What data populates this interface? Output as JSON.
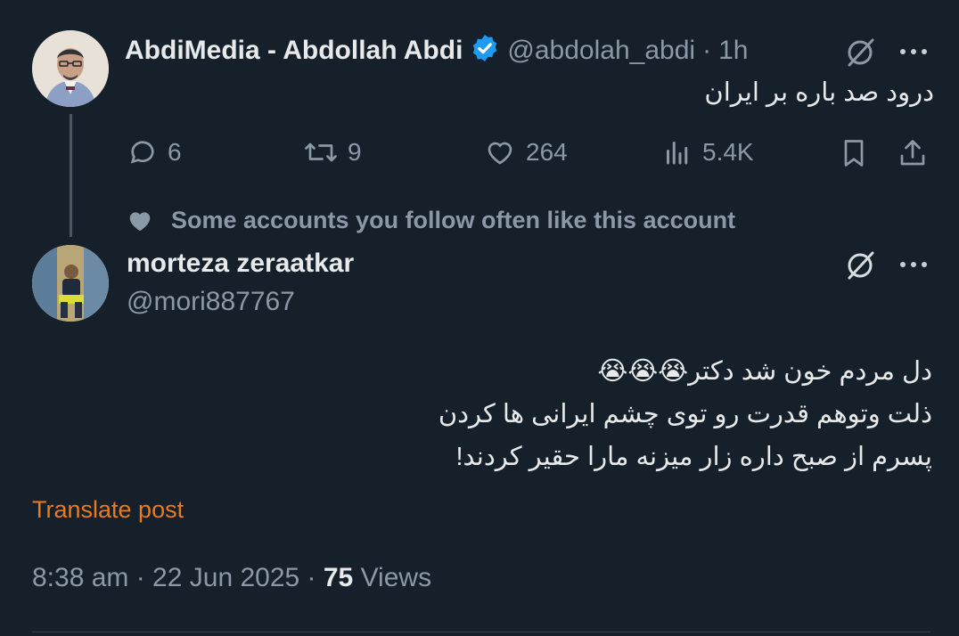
{
  "first_post": {
    "display_name": "AbdiMedia - Abdollah Abdi",
    "handle": "@abdolah_abdi",
    "separator": "·",
    "time": "1h",
    "text": "درود صد باره بر ایران",
    "stats": {
      "replies": "6",
      "reposts": "9",
      "likes": "264",
      "views": "5.4K"
    }
  },
  "social_context": "Some accounts you follow often like this account",
  "second_post": {
    "display_name": "morteza zeraatkar",
    "handle": "@mori887767",
    "lines": [
      "دل مردم خون شد دکتر😭😭😭",
      "ذلت وتوهم قدرت رو توی چشم ایرانی ها کردن",
      "پسرم از صبح داره زار میزنه مارا حقیر کردند!"
    ],
    "translate_label": "Translate post",
    "timestamp": "8:38 am · 22 Jun 2025 ·",
    "views_count": "75",
    "views_label": "Views"
  },
  "icons": {
    "verified": "verified-badge-icon",
    "grok": "grok-icon",
    "more": "more-options-icon"
  },
  "colors": {
    "background": "#15202b",
    "text": "#e7e9ea",
    "muted": "#8b98a5",
    "verified": "#1d9bf0",
    "translate": "#ea7a1e"
  }
}
